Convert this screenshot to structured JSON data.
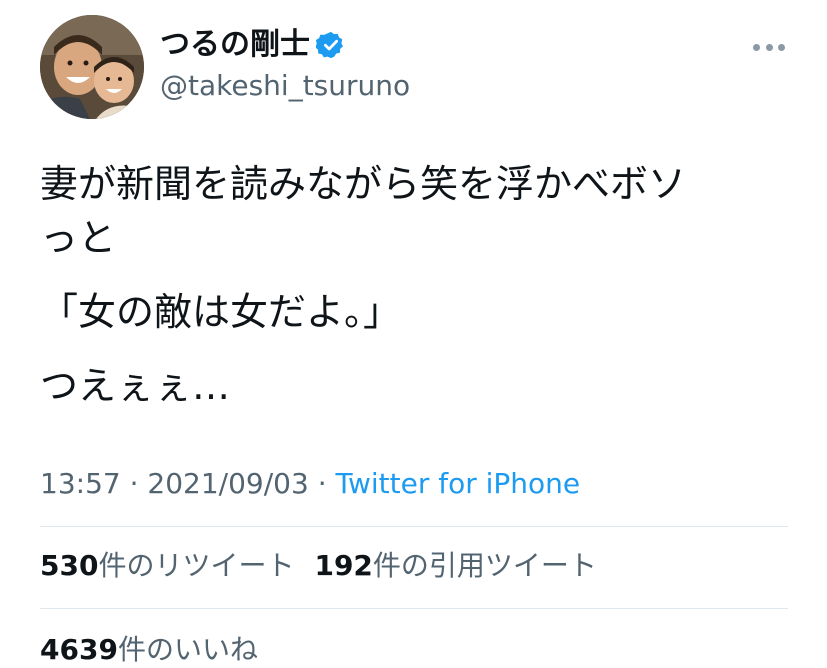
{
  "author": {
    "display_name": "つるの剛士",
    "handle": "@takeshi_tsuruno",
    "verified": true,
    "avatar_icon": "profile-photo",
    "verified_color": "#1d9bf0"
  },
  "tweet": {
    "lines": [
      "妻が新聞を読みながら笑を浮かべボソ",
      "っと",
      "「女の敵は女だよ。」",
      "つえぇぇ…"
    ]
  },
  "meta": {
    "time": "13:57",
    "separator1": " · ",
    "date": "2021/09/03",
    "separator2": " · ",
    "source": "Twitter for iPhone"
  },
  "stats": {
    "retweets": {
      "count": "530",
      "label": "件のリツイート"
    },
    "quotes": {
      "count": "192",
      "label": "件の引用ツイート"
    },
    "likes": {
      "count": "4639",
      "label": "件のいいね"
    }
  },
  "colors": {
    "text": "#0f1419",
    "secondary": "#536471",
    "link": "#1d9bf0",
    "divider": "#e1e8ed"
  }
}
